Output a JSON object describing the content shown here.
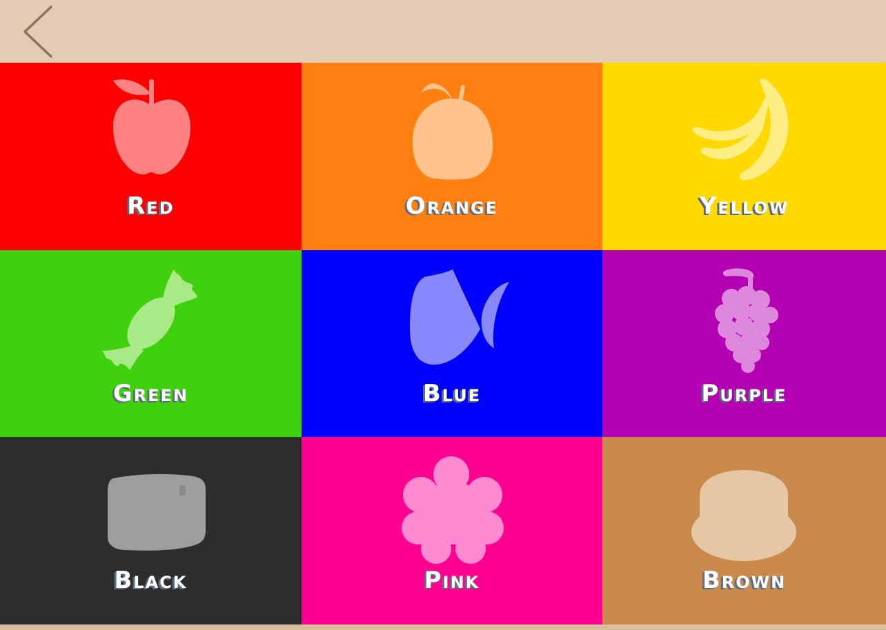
{
  "header": {
    "back_icon": "chevron-left-icon",
    "background": "#e2cdb4",
    "back_color": "#8b7359"
  },
  "tiles": [
    {
      "label": "Red",
      "background": "#ff0000",
      "shape_color": "#ff8282",
      "icon": "apple-icon"
    },
    {
      "label": "Orange",
      "background": "#ff7f11",
      "shape_color": "#ffc38b",
      "icon": "orange-fruit-icon"
    },
    {
      "label": "Yellow",
      "background": "#ffd800",
      "shape_color": "#ffee84",
      "icon": "banana-icon"
    },
    {
      "label": "Green",
      "background": "#3fd00e",
      "shape_color": "#a8ea88",
      "icon": "candy-icon"
    },
    {
      "label": "Blue",
      "background": "#0000ff",
      "shape_color": "#8888ff",
      "icon": "fish-icon"
    },
    {
      "label": "Purple",
      "background": "#b300b3",
      "shape_color": "#dd88dd",
      "icon": "grapes-icon"
    },
    {
      "label": "Black",
      "background": "#2d2d2d",
      "shape_color": "#9e9e9e",
      "icon": "stone-icon"
    },
    {
      "label": "Pink",
      "background": "#ff0090",
      "shape_color": "#ff8ad0",
      "icon": "flower-icon"
    },
    {
      "label": "Brown",
      "background": "#c98a4b",
      "shape_color": "#e6c7a5",
      "icon": "cake-icon"
    }
  ]
}
